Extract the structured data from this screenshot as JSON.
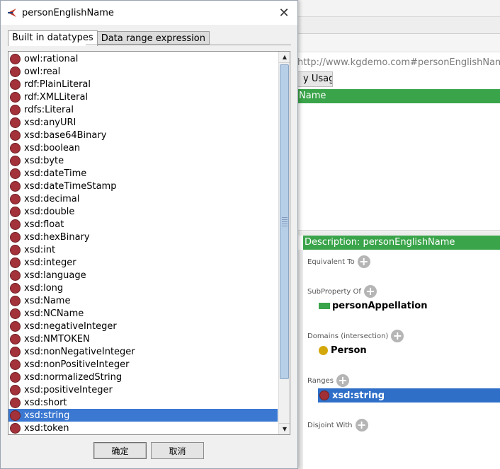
{
  "dialog": {
    "title": "personEnglishName",
    "tabs": [
      {
        "label": "Built in datatypes",
        "active": true
      },
      {
        "label": "Data range expression",
        "active": false
      }
    ],
    "datatypes": [
      "owl:rational",
      "owl:real",
      "rdf:PlainLiteral",
      "rdf:XMLLiteral",
      "rdfs:Literal",
      "xsd:anyURI",
      "xsd:base64Binary",
      "xsd:boolean",
      "xsd:byte",
      "xsd:dateTime",
      "xsd:dateTimeStamp",
      "xsd:decimal",
      "xsd:double",
      "xsd:float",
      "xsd:hexBinary",
      "xsd:int",
      "xsd:integer",
      "xsd:language",
      "xsd:long",
      "xsd:Name",
      "xsd:NCName",
      "xsd:negativeInteger",
      "xsd:NMTOKEN",
      "xsd:nonNegativeInteger",
      "xsd:nonPositiveInteger",
      "xsd:normalizedString",
      "xsd:positiveInteger",
      "xsd:short",
      "xsd:string",
      "xsd:token"
    ],
    "selected_datatype": "xsd:string",
    "ok_label": "确定",
    "cancel_label": "取消"
  },
  "background": {
    "iri": "http://www.kgdemo.com#personEnglishName",
    "usage_tab": "y Usage",
    "annotations_header": "Name",
    "description_header": "Description: personEnglishName",
    "sections": {
      "equivalent_to": "Equivalent To",
      "subproperty_of": "SubProperty Of",
      "domains": "Domains (intersection)",
      "ranges": "Ranges",
      "disjoint_with": "Disjoint With"
    },
    "subproperty_value": "personAppellation",
    "domain_value": "Person",
    "range_value": "xsd:string"
  },
  "colors": {
    "datatype_dot": "#a3323a",
    "selection": "#3b78d1",
    "green_header": "#3aa44a",
    "class_dot": "#d4a80b"
  }
}
